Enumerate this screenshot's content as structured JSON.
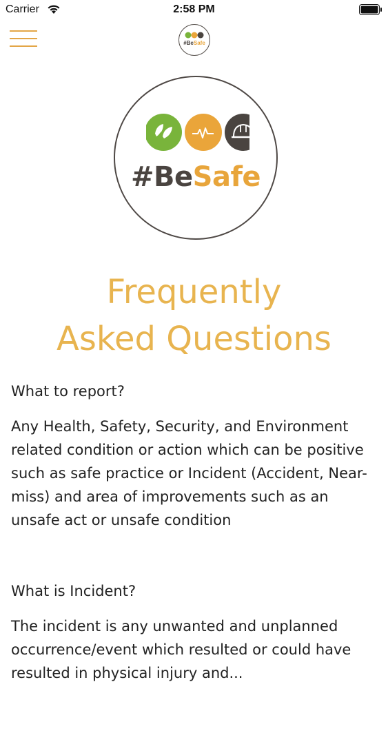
{
  "status_bar": {
    "carrier": "Carrier",
    "time": "2:58 PM",
    "wifi_icon": "wifi-icon",
    "battery_icon": "battery-icon"
  },
  "nav": {
    "menu_icon": "hamburger-menu-icon",
    "logo_text_main": "#Be",
    "logo_text_accent": "Safe"
  },
  "brand": {
    "text_main": "#Be",
    "text_accent": "Safe",
    "colors": {
      "green": "#79b43b",
      "orange": "#eaa53a",
      "dark": "#4a4440",
      "title": "#e8b44f"
    }
  },
  "page": {
    "title_line1": "Frequently",
    "title_line2": "Asked Questions"
  },
  "faqs": [
    {
      "question": "What to report?",
      "answer": "Any Health, Safety, Security, and Environment related condition or action which can be positive such as safe practice or Incident (Accident, Near-miss) and area of improvements such as an unsafe act or unsafe condition"
    },
    {
      "question": "What is Incident?",
      "answer": "The incident is any unwanted and unplanned occurrence/event which resulted or could have resulted in physical injury and..."
    }
  ]
}
